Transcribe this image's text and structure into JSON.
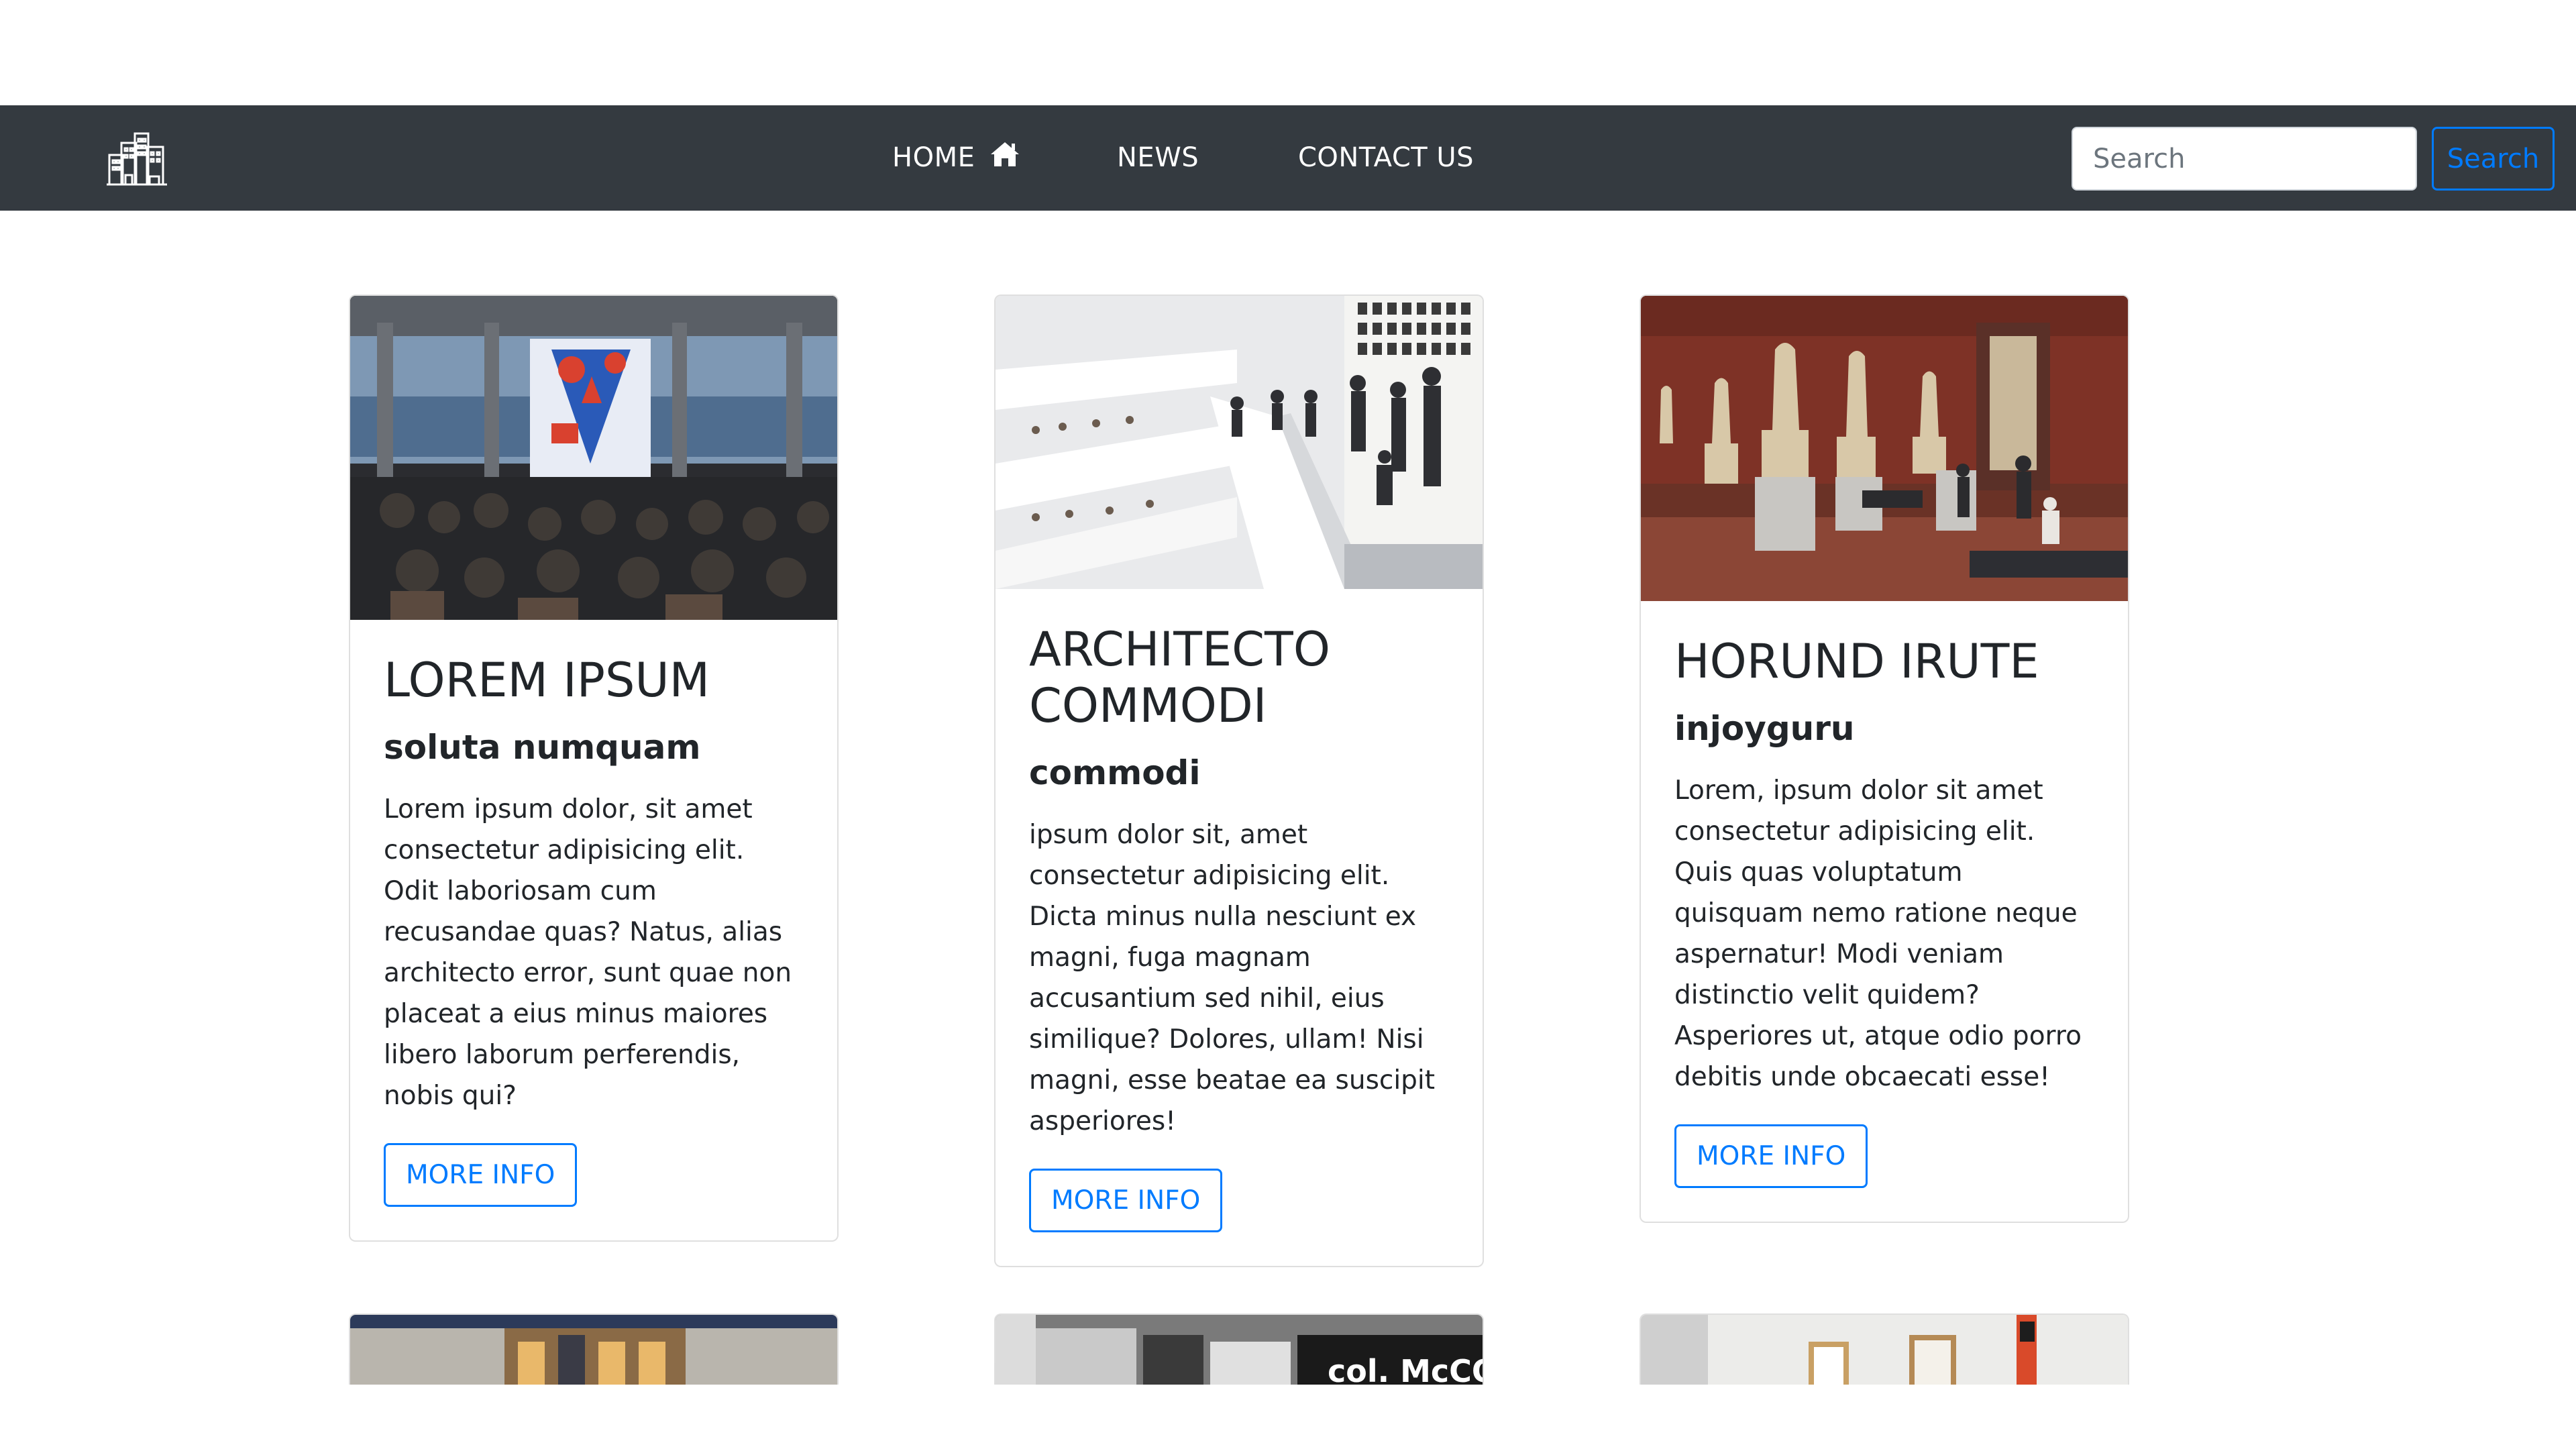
{
  "navbar": {
    "brand_icon": "city-buildings-icon",
    "links": [
      {
        "label": "HOME",
        "icon": "home-icon"
      },
      {
        "label": "NEWS"
      },
      {
        "label": "CONTACT US"
      }
    ],
    "search": {
      "placeholder": "Search",
      "value": "",
      "button_label": "Search"
    },
    "background_color": "#343a40",
    "accent_color": "#007bff"
  },
  "cards": [
    {
      "image": "event-hall-audience-photo",
      "title": "LOREM IPSUM",
      "subtitle": "soluta numquam",
      "text": "Lorem ipsum dolor, sit amet consectetur adipisicing elit. Odit laboriosam cum recusandae quas? Natus, alias architecto error, sunt quae non placeat a eius minus maiores libero laborum perferendis, nobis qui?",
      "button_label": "MORE INFO"
    },
    {
      "image": "museum-spiral-ramp-photo",
      "title": "ARCHITECTO COMMODI",
      "subtitle": "commodi",
      "text": "ipsum dolor sit, amet consectetur adipisicing elit. Dicta minus nulla nesciunt ex magni, fuga magnam accusantium sed nihil, eius similique? Dolores, ullam! Nisi magni, esse beatae ea suscipit asperiores!",
      "button_label": "MORE INFO"
    },
    {
      "image": "sculpture-gallery-photo",
      "title": "HORUND IRUTE",
      "subtitle": "injoyguru",
      "text": "Lorem, ipsum dolor sit amet consectetur adipisicing elit. Quis quas voluptatum quisquam nemo ratione neque aspernatur! Modi veniam distinctio velit quidem? Asperiores ut, atque odio porro debitis unde obcaecati esse!",
      "button_label": "MORE INFO"
    }
  ],
  "partial_cards": [
    {
      "image": "ornate-building-facade-photo"
    },
    {
      "image": "black-white-posters-photo",
      "visible_text": "col. McCOY'S"
    },
    {
      "image": "white-gallery-room-photo"
    }
  ]
}
